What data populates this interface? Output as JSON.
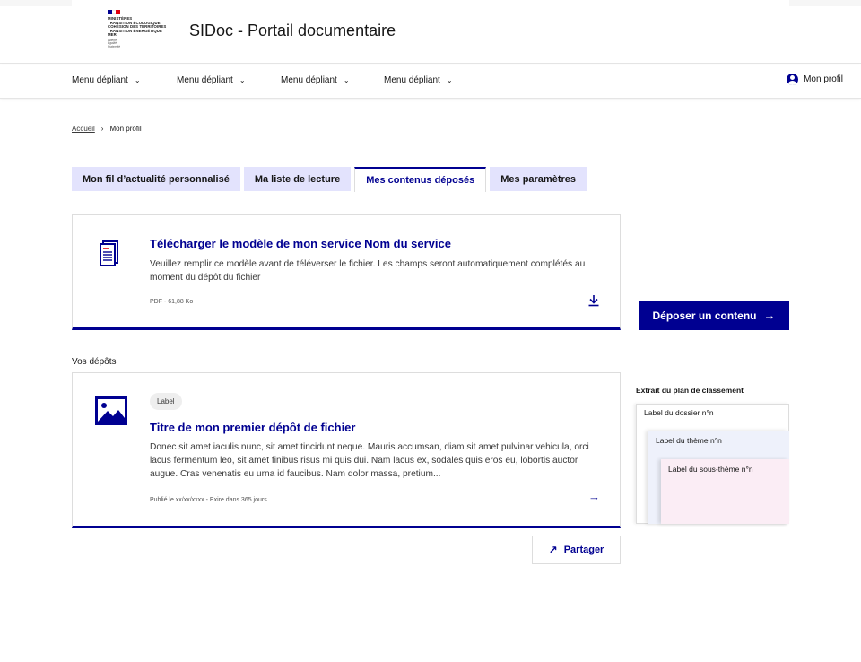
{
  "header": {
    "ministry_text": "MINISTÈRES\nTRANSITION ÉCOLOGIQUE\nCOHÉSION DES TERRITOIRES\nTRANSITION ÉNERGÉTIQUE\nMER",
    "devise": "Liberté\nÉgalité\nFraternité",
    "site_title": "SIDoc - Portail documentaire",
    "flag_colors": [
      "#000091",
      "#ffffff",
      "#e1000f"
    ]
  },
  "nav": {
    "items": [
      {
        "label": "Menu dépliant",
        "icon": "chevron-down-icon"
      },
      {
        "label": "Menu dépliant",
        "icon": "chevron-down-icon"
      },
      {
        "label": "Menu dépliant",
        "icon": "chevron-down-icon"
      },
      {
        "label": "Menu dépliant",
        "icon": "chevron-down-icon"
      }
    ],
    "profile_label": "Mon profil",
    "profile_icon": "user-circle-icon"
  },
  "breadcrumb": {
    "home": "Accueil",
    "current": "Mon profil"
  },
  "tabs": [
    {
      "label": "Mon fil d’actualité personnalisé",
      "active": false
    },
    {
      "label": "Ma liste de lecture",
      "active": false
    },
    {
      "label": "Mes contenus déposés",
      "active": true
    },
    {
      "label": "Mes paramètres",
      "active": false
    }
  ],
  "download_card": {
    "title": "Télécharger le modèle de mon service Nom du service",
    "description": "Veuillez remplir ce modèle avant de téléverser le fichier. Les champs  seront automatiquement complétés au moment du dépôt du fichier",
    "meta": "PDF - 61,88 Ko",
    "icon": "document-icon",
    "action_icon": "download-icon"
  },
  "deposit_button": {
    "label": "Déposer un contenu",
    "icon": "arrow-right-icon"
  },
  "deposits": {
    "section_label": "Vos dépôts",
    "card": {
      "badge": "Label",
      "title": "Titre de mon premier dépôt de fichier",
      "description": "Donec sit amet iaculis nunc, sit amet tincidunt neque. Mauris accumsan,  diam sit amet pulvinar vehicula, orci lacus fermentum leo, sit amet  finibus risus mi quis dui. Nam lacus ex, sodales quis eros eu, lobortis  auctor augue. Cras venenatis eu urna id faucibus. Nam dolor massa,  pretium...",
      "meta": "Publié le xx/xx/xxxx - Exire dans 365 jours",
      "icon": "image-icon",
      "action_icon": "arrow-right-icon"
    },
    "share_label": "Partager",
    "share_icon": "external-link-icon"
  },
  "classification": {
    "title": "Extrait du plan de classement",
    "folder": "Label du dossier n°n",
    "theme": "Label du thème n°n",
    "subtheme": "Label du sous-thème n°n"
  },
  "colors": {
    "primary": "#000091",
    "tab_bg": "#e3e3fd",
    "accent_red": "#e1000f",
    "theme_bg": "#eef1fb",
    "subtheme_bg": "#fbedf5"
  }
}
